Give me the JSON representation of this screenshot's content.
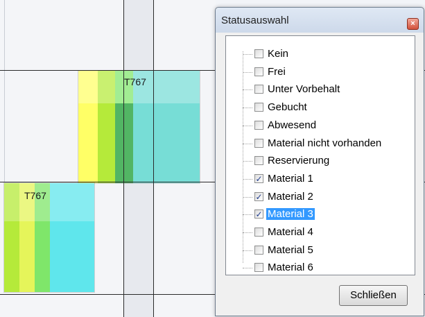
{
  "bookings": {
    "upper_label": "T767",
    "lower_label": "T767"
  },
  "dialog": {
    "title": "Statusauswahl",
    "close_icon": "close-icon",
    "items": [
      {
        "label": "Kein",
        "checked": false,
        "selected": false
      },
      {
        "label": "Frei",
        "checked": false,
        "selected": false
      },
      {
        "label": "Unter Vorbehalt",
        "checked": false,
        "selected": false
      },
      {
        "label": "Gebucht",
        "checked": false,
        "selected": false
      },
      {
        "label": "Abwesend",
        "checked": false,
        "selected": false
      },
      {
        "label": "Material nicht vorhanden",
        "checked": false,
        "selected": false
      },
      {
        "label": "Reservierung",
        "checked": false,
        "selected": false
      },
      {
        "label": "Material 1",
        "checked": true,
        "selected": false
      },
      {
        "label": "Material 2",
        "checked": true,
        "selected": false
      },
      {
        "label": "Material 3",
        "checked": true,
        "selected": true
      },
      {
        "label": "Material 4",
        "checked": false,
        "selected": false
      },
      {
        "label": "Material 5",
        "checked": false,
        "selected": false
      },
      {
        "label": "Material 6",
        "checked": false,
        "selected": false
      }
    ],
    "close_button_label": "Schließen",
    "check_glyph": "✓"
  }
}
